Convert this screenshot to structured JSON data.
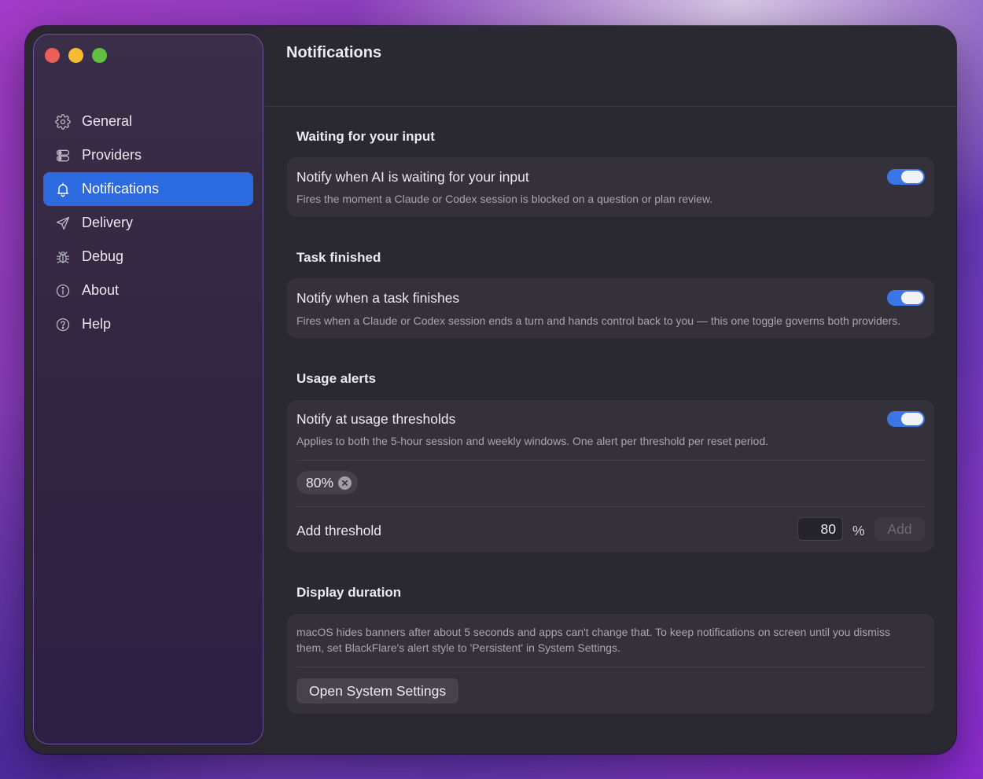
{
  "sidebar": {
    "items": [
      {
        "label": "General",
        "icon": "gear-icon"
      },
      {
        "label": "Providers",
        "icon": "toggles-icon"
      },
      {
        "label": "Notifications",
        "icon": "bell-icon",
        "active": true
      },
      {
        "label": "Delivery",
        "icon": "paper-plane-icon"
      },
      {
        "label": "Debug",
        "icon": "bug-icon"
      },
      {
        "label": "About",
        "icon": "info-icon"
      },
      {
        "label": "Help",
        "icon": "question-icon"
      }
    ]
  },
  "header": {
    "title": "Notifications"
  },
  "sections": {
    "waiting": {
      "title": "Waiting for your input",
      "row_title": "Notify when AI is waiting for your input",
      "row_desc": "Fires the moment a Claude or Codex session is blocked on a question or plan review.",
      "enabled": true
    },
    "task": {
      "title": "Task finished",
      "row_title": "Notify when a task finishes",
      "row_desc": "Fires when a Claude or Codex session ends a turn and hands control back to you — this one toggle governs both providers.",
      "enabled": true
    },
    "usage": {
      "title": "Usage alerts",
      "row_title": "Notify at usage thresholds",
      "row_desc": "Applies to both the 5-hour session and weekly windows. One alert per threshold per reset period.",
      "enabled": true,
      "thresholds": [
        "80%"
      ],
      "add_label": "Add threshold",
      "input_value": "80",
      "unit": "%",
      "add_button": "Add"
    },
    "display": {
      "title": "Display duration",
      "desc_line1": "macOS hides banners after about 5 seconds and apps can't change that. To keep notifications on screen until you dismiss",
      "desc_line2": "them, set BlackFlare's alert style to 'Persistent' in System Settings.",
      "button": "Open System Settings"
    }
  },
  "colors": {
    "accent": "#2c6ae0",
    "toggle_on": "#3b76e6",
    "window_bg": "#2a2830",
    "card_bg": "#34313a"
  }
}
